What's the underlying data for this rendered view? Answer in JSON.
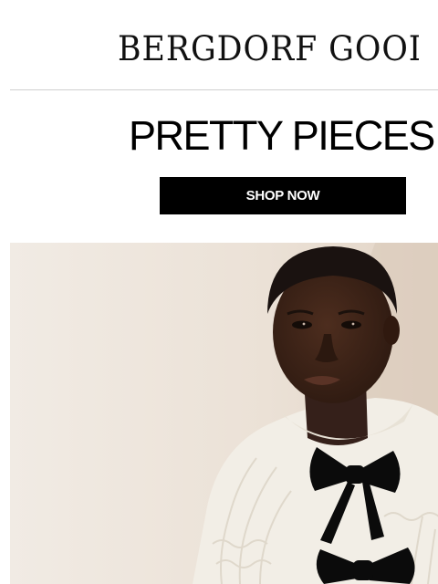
{
  "brand": {
    "logo_text": "BERGDORF GOODMAN"
  },
  "promo": {
    "headline": "PRETTY PIECES",
    "cta_label": "SHOP NOW"
  },
  "hero": {
    "image_alt": "Model wearing a white cable-knit cardigan with black velvet bows",
    "colors": {
      "background": "#ede5dc",
      "skin": "#3e2418",
      "hair": "#1a1210",
      "sweater": "#f3efe6",
      "bow": "#0c0c0c"
    }
  }
}
